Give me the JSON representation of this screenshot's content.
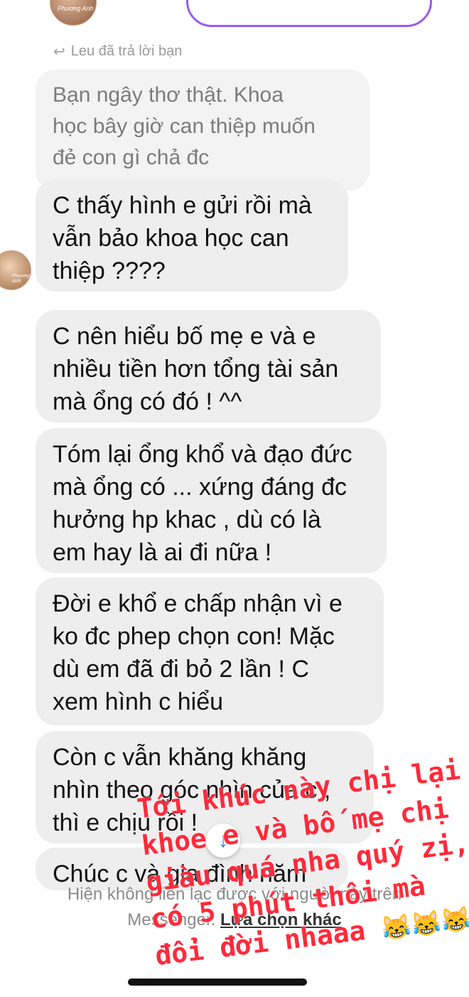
{
  "reply_indicator": "Leu đã trả lời bạn",
  "top_avatar_label": "Phương Anh",
  "quoted_message": "Bạn ngây thơ thật. Khoa\nhọc bây giờ can thiệp muốn\nđẻ con gì chả đc",
  "messages": [
    "C thấy hình e gửi rồi mà\nvẫn bảo khoa học can\nthiệp ????",
    "C nên hiểu bố mẹ e và e\nnhiều tiền hơn tổng tài sản\nmà ổng có đó ! ^^",
    "Tóm lại ổng khổ và đạo đức\nmà ổng có ... xứng đáng đc\nhưởng hp khac , dù có là\nem hay là ai đi nữa !",
    "Đời e khổ e chấp nhận vì e\nko đc phep chọn con! Mặc\ndù em đã đi bỏ 2 lần ! C\nxem hình c hiểu",
    "Còn c vẫn khăng khăng\nnhìn theo góc nhìn của c ,\nthì e chịu rồi !",
    "Chúc c và gia đình năm"
  ],
  "blocked_note": {
    "line1": "Hiện không liên lạc được với người này trên",
    "line2": "Messenger.",
    "other_options": "Lựa chọn khác"
  },
  "overlay_caption": [
    "Tới khúc này chị lại",
    "khoe e và bố mẹ chị",
    "giàu quá nha quý zị,",
    "có 5 phút thôi mà",
    "đổi đời nhaaa"
  ],
  "overlay_emoji": "😹😹😹",
  "colors": {
    "bubble": "#eeeeef",
    "overlay_text": "#ff2a3a",
    "accent": "#9b59f5"
  }
}
